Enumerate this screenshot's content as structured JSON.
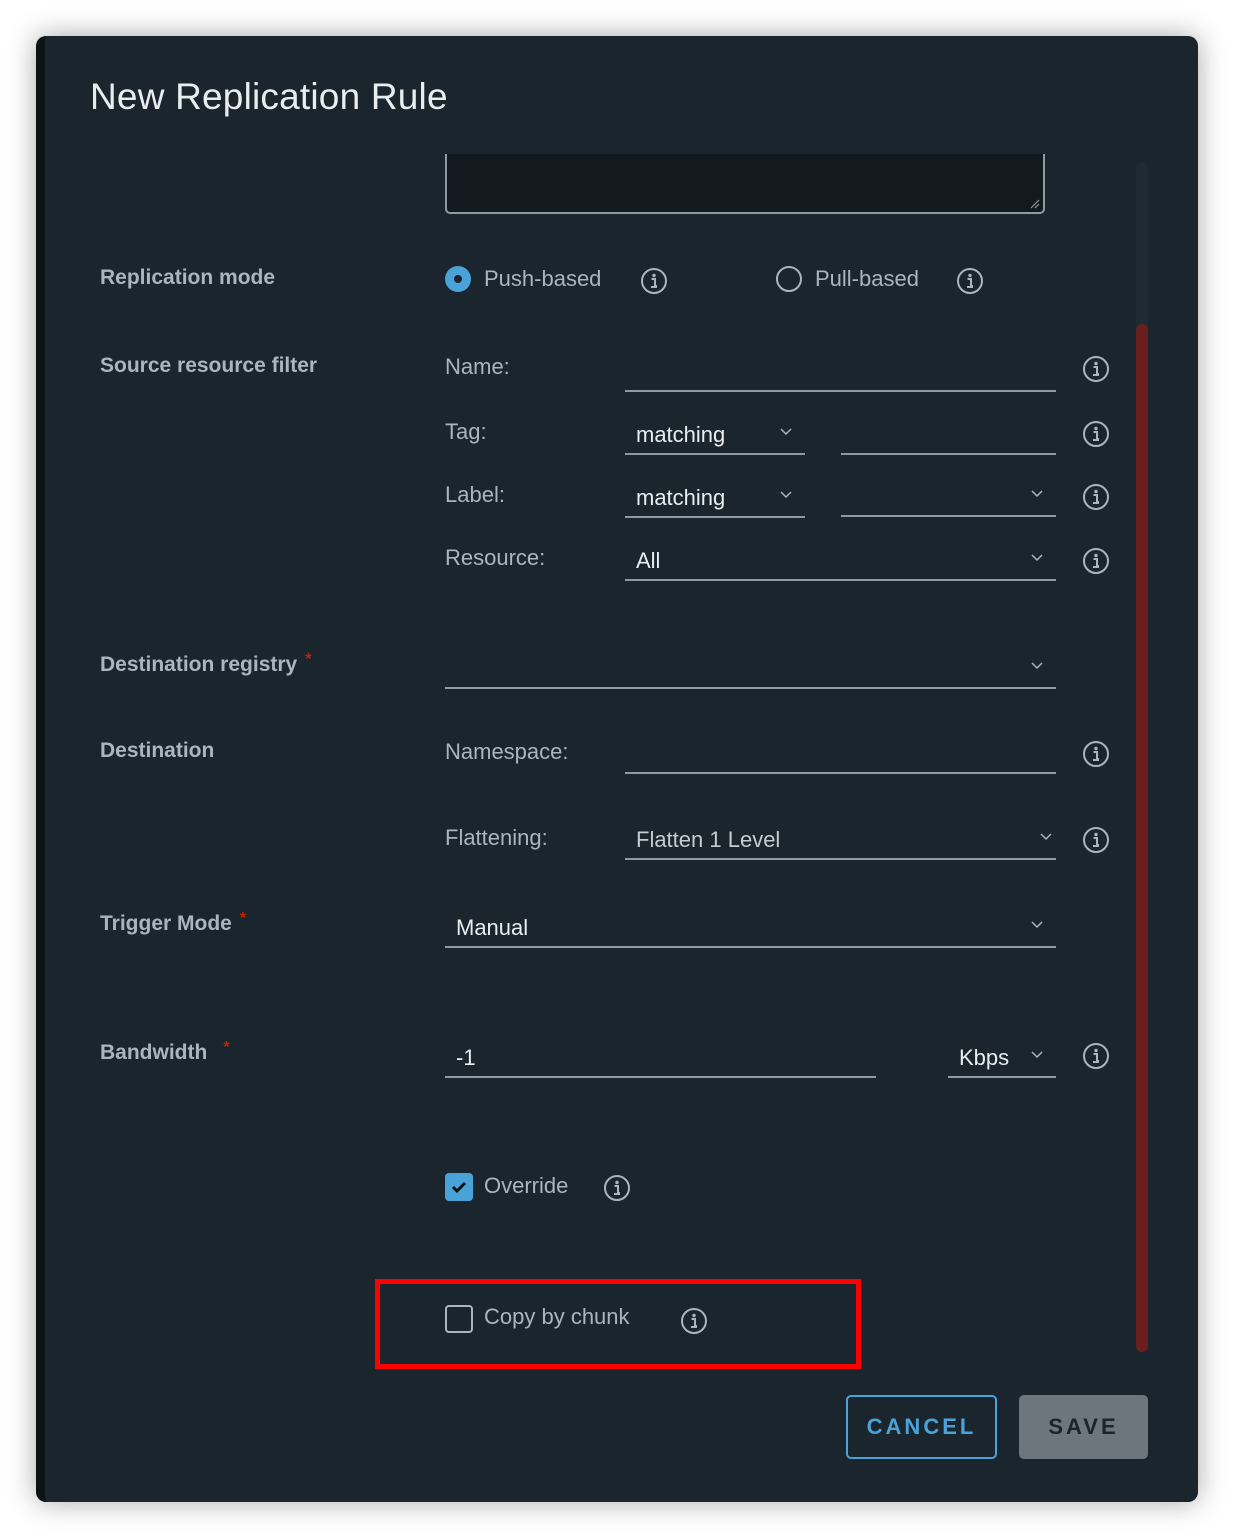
{
  "dialog": {
    "title": "New Replication Rule"
  },
  "replication_mode": {
    "label": "Replication mode",
    "options": [
      {
        "label": "Push-based",
        "selected": true
      },
      {
        "label": "Pull-based",
        "selected": false
      }
    ]
  },
  "source_filter": {
    "label": "Source resource filter",
    "name_label": "Name:",
    "name_value": "",
    "tag_label": "Tag:",
    "tag_mode": "matching",
    "tag_value": "",
    "label_label": "Label:",
    "label_mode": "matching",
    "label_value": "",
    "resource_label": "Resource:",
    "resource_value": "All"
  },
  "destination_registry": {
    "label": "Destination registry",
    "required_mark": "*",
    "value": ""
  },
  "destination": {
    "label": "Destination",
    "namespace_label": "Namespace:",
    "namespace_value": "",
    "flattening_label": "Flattening:",
    "flattening_value": "Flatten 1 Level"
  },
  "trigger_mode": {
    "label": "Trigger Mode",
    "required_mark": "*",
    "value": "Manual"
  },
  "bandwidth": {
    "label": "Bandwidth",
    "required_mark": "*",
    "value": "-1",
    "unit": "Kbps"
  },
  "override": {
    "label": "Override",
    "checked": true
  },
  "copy_by_chunk": {
    "label": "Copy by chunk",
    "checked": false
  },
  "footer": {
    "cancel_label": "CANCEL",
    "save_label": "SAVE"
  },
  "colors": {
    "accent": "#49a3d9",
    "background": "#1b252d",
    "required": "#c92100",
    "highlight": "#ff0000",
    "scrollbar_thumb": "#6b1e1e"
  }
}
